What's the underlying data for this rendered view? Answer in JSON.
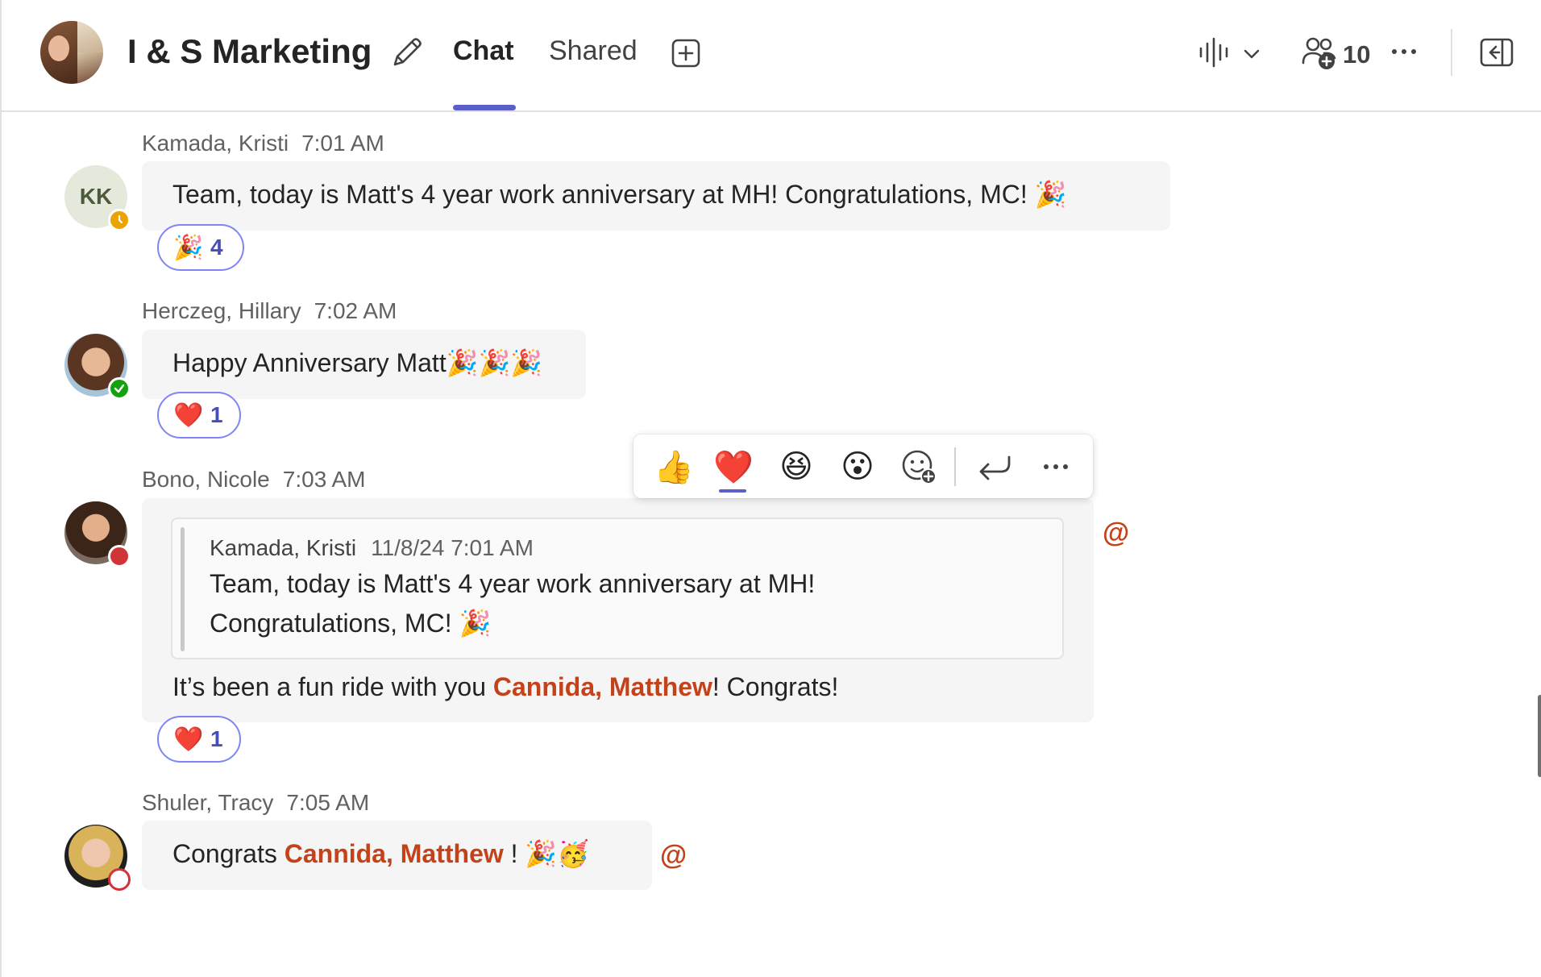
{
  "header": {
    "title": "I & S Marketing",
    "tabs": [
      {
        "label": "Chat",
        "active": true
      },
      {
        "label": "Shared",
        "active": false
      }
    ],
    "participants_count": "10",
    "icons": [
      "edit-icon",
      "add-tab-icon",
      "call-icon",
      "chevron-down-icon",
      "people-icon",
      "more-icon",
      "panel-icon"
    ]
  },
  "messages": [
    {
      "sender": "Kamada, Kristi",
      "time": "7:01 AM",
      "initials": "KK",
      "status": "away",
      "text": "Team, today is Matt's 4 year work anniversary at MH! Congratulations, MC! 🎉",
      "reaction": {
        "emoji": "🎉",
        "count": "4"
      }
    },
    {
      "sender": "Herczeg, Hillary",
      "time": "7:02 AM",
      "status": "available",
      "text": "Happy Anniversary Matt🎉🎉🎉",
      "reaction": {
        "emoji": "❤️",
        "count": "1"
      }
    },
    {
      "sender": "Bono, Nicole",
      "time": "7:03 AM",
      "status": "busy",
      "quote": {
        "sender": "Kamada, Kristi",
        "timestamp": "11/8/24 7:01 AM",
        "line1": "Team, today is Matt's 4 year work anniversary at MH!",
        "line2": "Congratulations, MC! 🎉"
      },
      "text_before": "It’s been a fun ride with you ",
      "mention": "Cannida, Matthew",
      "text_after": "! Congrats!",
      "reaction": {
        "emoji": "❤️",
        "count": "1"
      },
      "at_icon": "@"
    },
    {
      "sender": "Shuler, Tracy",
      "time": "7:05 AM",
      "status": "offline",
      "text_before": "Congrats ",
      "mention": "Cannida, Matthew",
      "text_after": " ! 🎉🥳",
      "at_icon": "@"
    }
  ],
  "hover_toolbar": {
    "reactions": [
      "👍",
      "❤️",
      "😆",
      "😮"
    ],
    "icons": [
      "add-reaction-icon",
      "reply-icon",
      "more-icon"
    ]
  },
  "colors": {
    "accent": "#5b5fc7",
    "mention": "#c4421a",
    "bubble": "#f5f5f5",
    "away": "#eaa300",
    "available": "#13a10e",
    "busy": "#d13438"
  }
}
